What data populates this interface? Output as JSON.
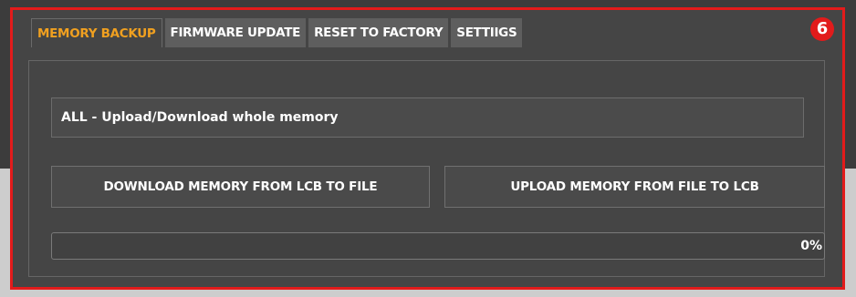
{
  "tabs": [
    {
      "label": "MEMORY BACKUP"
    },
    {
      "label": "FIRMWARE UPDATE"
    },
    {
      "label": "RESET TO FACTORY"
    },
    {
      "label": "SETTIIGS"
    }
  ],
  "badge": "6",
  "memory_backup": {
    "mode_value": "ALL - Upload/Download whole memory",
    "download_button": "DOWNLOAD MEMORY FROM LCB TO FILE",
    "upload_button": "UPLOAD MEMORY FROM FILE TO LCB",
    "progress_text": "0%",
    "progress_fraction": 0
  },
  "colors": {
    "active_tab_text": "#f0a020",
    "highlight_border": "#e21b1b",
    "panel_background": "#454545"
  }
}
